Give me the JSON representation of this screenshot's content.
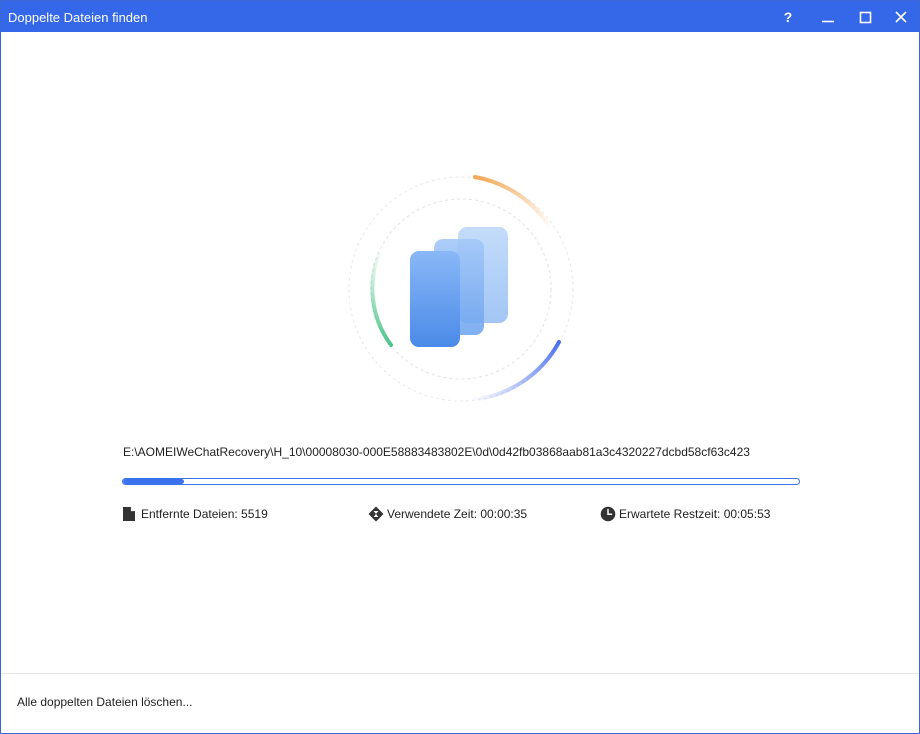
{
  "window": {
    "title": "Doppelte Dateien finden",
    "help_label": "?"
  },
  "scan": {
    "current_path": "E:\\AOMEIWeChatRecovery\\H_10\\00008030-000E58883483802E\\0d\\0d42fb03868aab81a3c4320227dcbd58cf63c423",
    "progress_fraction": 0.09
  },
  "stats": {
    "removed_files": "Entfernte Dateien: 5519",
    "time_used": "Verwendete Zeit: 00:00:35",
    "time_remaining": "Erwartete Restzeit: 00:05:53"
  },
  "footer": {
    "delete_all_label": "Alle doppelten Dateien löschen..."
  },
  "colors": {
    "titlebar": "#3468e8",
    "accent": "#3b73ee",
    "ring_orange": "#f3a857",
    "ring_green": "#4cc58a",
    "ring_blue": "#4a6ff0"
  },
  "icons": {
    "help": "help-icon",
    "minimize": "minimize-icon",
    "maximize": "maximize-icon",
    "close": "close-icon",
    "file": "file-icon",
    "time_used": "hourglass-diamond-icon",
    "time_remaining": "clock-icon"
  }
}
